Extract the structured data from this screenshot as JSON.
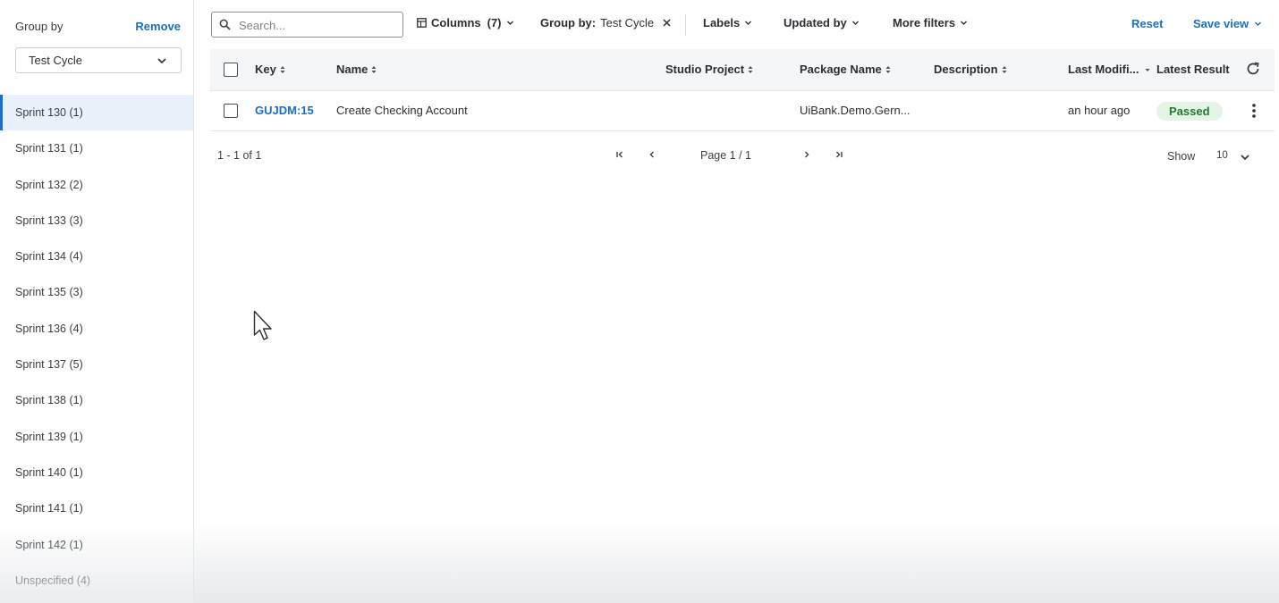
{
  "sidebar": {
    "title": "Group by",
    "remove_label": "Remove",
    "select_value": "Test Cycle",
    "items": [
      {
        "label": "Sprint 130 (1)",
        "active": true
      },
      {
        "label": "Sprint 131 (1)"
      },
      {
        "label": "Sprint 132 (2)"
      },
      {
        "label": "Sprint 133 (3)"
      },
      {
        "label": "Sprint 134 (4)"
      },
      {
        "label": "Sprint 135 (3)"
      },
      {
        "label": "Sprint 136 (4)"
      },
      {
        "label": "Sprint 137 (5)"
      },
      {
        "label": "Sprint 138 (1)"
      },
      {
        "label": "Sprint 139 (1)"
      },
      {
        "label": "Sprint 140 (1)"
      },
      {
        "label": "Sprint 141 (1)"
      },
      {
        "label": "Sprint 142 (1)"
      },
      {
        "label": "Unspecified (4)"
      }
    ]
  },
  "toolbar": {
    "search_placeholder": "Search...",
    "columns_label": "Columns",
    "columns_count": "(7)",
    "group_by_prefix": "Group by:",
    "group_by_value": "Test Cycle",
    "labels_label": "Labels",
    "updated_by_label": "Updated by",
    "more_filters_label": "More filters",
    "reset_label": "Reset",
    "save_view_label": "Save view"
  },
  "table": {
    "headers": {
      "key": "Key",
      "name": "Name",
      "studio_project": "Studio Project",
      "package_name": "Package Name",
      "description": "Description",
      "last_modified": "Last Modifi...",
      "latest_result": "Latest Result"
    },
    "rows": [
      {
        "key": "GUJDM:15",
        "name": "Create Checking Account",
        "studio_project": "",
        "package_name": "UiBank.Demo.Gern...",
        "description": "",
        "last_modified": "an hour ago",
        "latest_result": "Passed"
      }
    ]
  },
  "pagination": {
    "range": "1 - 1 of 1",
    "page_label": "Page 1 / 1",
    "show_label": "Show",
    "page_size": "10"
  },
  "colors": {
    "accent": "#1a6fc4",
    "active_bg": "#e9f1fb",
    "passed_bg": "#e4f5e6",
    "passed_text": "#1f7a33"
  }
}
